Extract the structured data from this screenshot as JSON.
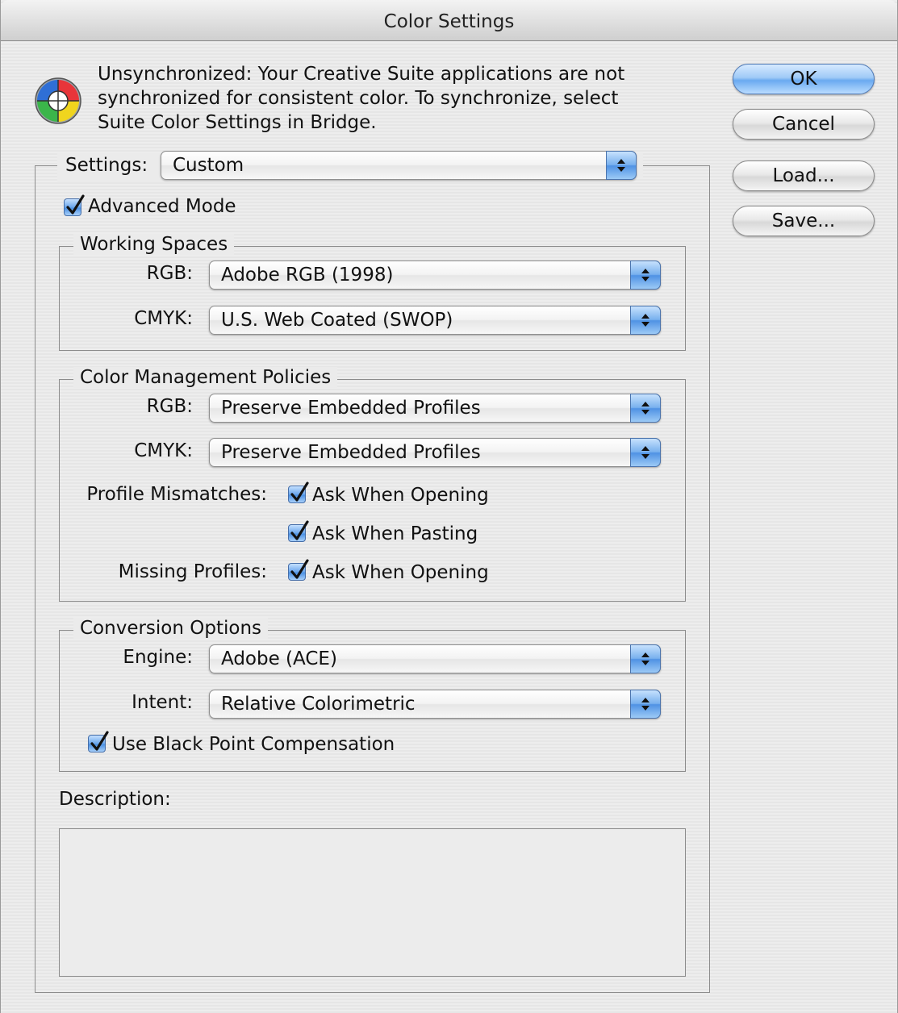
{
  "window": {
    "title": "Color Settings"
  },
  "sync": {
    "icon": "color-wheel-icon",
    "message": "Unsynchronized: Your Creative Suite applications are not synchronized for consistent color. To synchronize, select Suite Color Settings in Bridge."
  },
  "buttons": {
    "ok": "OK",
    "cancel": "Cancel",
    "load": "Load...",
    "save": "Save..."
  },
  "settings": {
    "label": "Settings:",
    "value": "Custom"
  },
  "advanced_mode": {
    "label": "Advanced Mode",
    "checked": true
  },
  "working_spaces": {
    "title": "Working Spaces",
    "rgb_label": "RGB:",
    "rgb_value": "Adobe RGB (1998)",
    "cmyk_label": "CMYK:",
    "cmyk_value": "U.S. Web Coated (SWOP)"
  },
  "policies": {
    "title": "Color Management Policies",
    "rgb_label": "RGB:",
    "rgb_value": "Preserve Embedded Profiles",
    "cmyk_label": "CMYK:",
    "cmyk_value": "Preserve Embedded Profiles",
    "mismatch_label": "Profile Mismatches:",
    "ask_opening": "Ask When Opening",
    "ask_pasting": "Ask When Pasting",
    "missing_label": "Missing Profiles:",
    "missing_ask_opening": "Ask When Opening"
  },
  "conversion": {
    "title": "Conversion Options",
    "engine_label": "Engine:",
    "engine_value": "Adobe (ACE)",
    "intent_label": "Intent:",
    "intent_value": "Relative Colorimetric",
    "bpc_label": "Use Black Point Compensation"
  },
  "description": {
    "label": "Description:",
    "text": ""
  },
  "colors": {
    "accent": "#4f92e4",
    "default_button": "#8fc1f5"
  }
}
